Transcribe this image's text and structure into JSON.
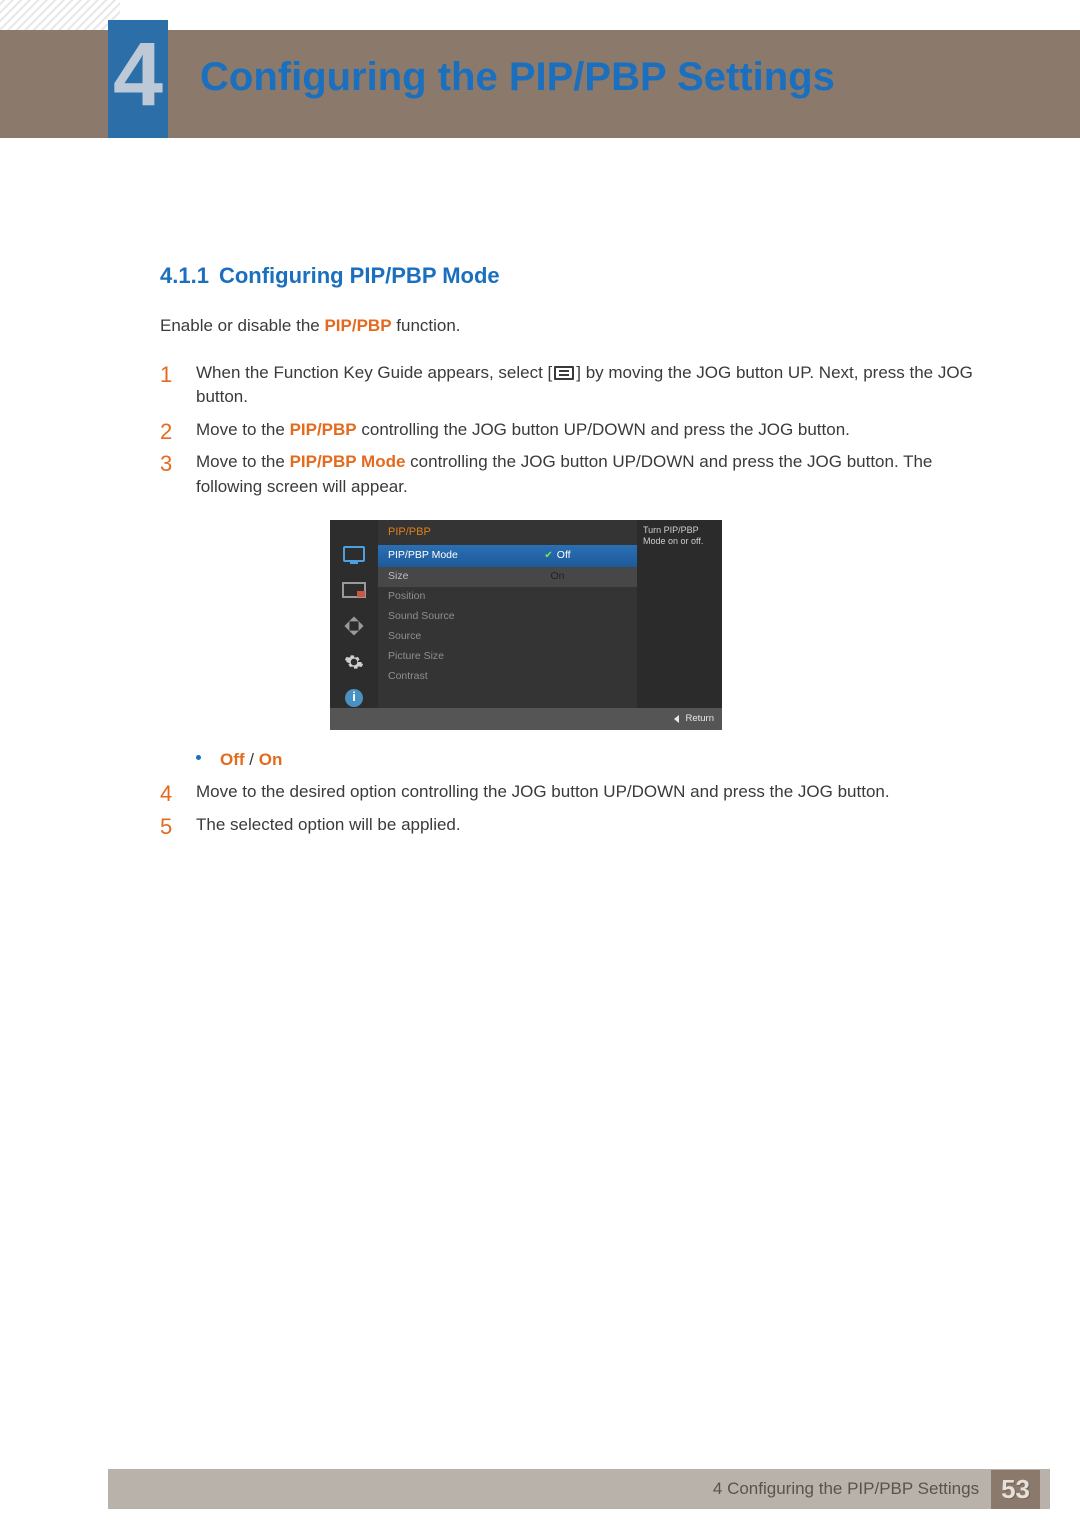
{
  "chapter": {
    "number": "4",
    "title": "Configuring the PIP/PBP Settings"
  },
  "section": {
    "number": "4.1.1",
    "title": "Configuring PIP/PBP Mode"
  },
  "intro": {
    "pre": "Enable or disable the ",
    "hl": "PIP/PBP",
    "post": " function."
  },
  "steps": [
    {
      "n": "1",
      "parts": [
        {
          "t": "When the Function Key Guide appears, select ["
        },
        {
          "icon": "menu"
        },
        {
          "t": "] by moving the JOG button UP. Next, press the JOG button."
        }
      ]
    },
    {
      "n": "2",
      "parts": [
        {
          "t": "Move to the "
        },
        {
          "hl": "PIP/PBP"
        },
        {
          "t": " controlling the JOG button UP/DOWN and press the JOG button."
        }
      ]
    },
    {
      "n": "3",
      "parts": [
        {
          "t": "Move to the "
        },
        {
          "hl": "PIP/PBP Mode"
        },
        {
          "t": " controlling the JOG button UP/DOWN and press the JOG button. The following screen will appear."
        }
      ]
    }
  ],
  "osd": {
    "header": "PIP/PBP",
    "rows": [
      {
        "label": "PIP/PBP Mode",
        "value": "Off",
        "selected": true,
        "check": true
      },
      {
        "label": "Size",
        "value": "On",
        "kind": "size"
      },
      {
        "label": "Position",
        "value": ""
      },
      {
        "label": "Sound Source",
        "value": ""
      },
      {
        "label": "Source",
        "value": ""
      },
      {
        "label": "Picture Size",
        "value": ""
      },
      {
        "label": "Contrast",
        "value": ""
      }
    ],
    "hint": "Turn PIP/PBP Mode on or off.",
    "return_label": "Return"
  },
  "options_line": {
    "a": "Off",
    "sep": " / ",
    "b": "On"
  },
  "steps2": [
    {
      "n": "4",
      "text": "Move to the desired option controlling the JOG button UP/DOWN and press the JOG button."
    },
    {
      "n": "5",
      "text": "The selected option will be applied."
    }
  ],
  "footer": {
    "text": "4 Configuring the PIP/PBP Settings",
    "page": "53"
  }
}
